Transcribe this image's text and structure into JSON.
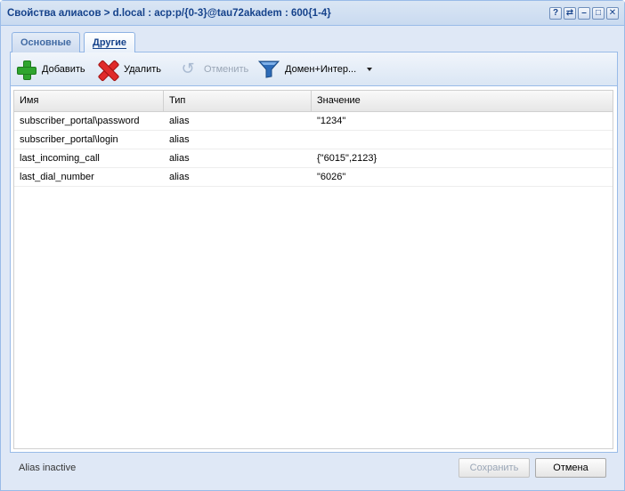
{
  "window": {
    "title": "Свойства алиасов > d.local : acp:p/{0-3}@tau72akadem : 600{1-4}",
    "tool_buttons": [
      "?",
      "⇄",
      "–",
      "□",
      "✕"
    ]
  },
  "tabs": [
    {
      "label": "Основные",
      "active": false
    },
    {
      "label": "Другие",
      "active": true
    }
  ],
  "toolbar": {
    "add_label": "Добавить",
    "delete_label": "Удалить",
    "undo_label": "Отменить",
    "filter_label": "Домен+Интер..."
  },
  "grid": {
    "columns": [
      "Имя",
      "Тип",
      "Значение"
    ],
    "rows": [
      [
        "subscriber_portal\\password",
        "alias",
        "\"1234\""
      ],
      [
        "subscriber_portal\\login",
        "alias",
        ""
      ],
      [
        "last_incoming_call",
        "alias",
        "{\"6015\",2123}"
      ],
      [
        "last_dial_number",
        "alias",
        "\"6026\""
      ]
    ]
  },
  "footer": {
    "status": "Alias inactive",
    "save_label": "Сохранить",
    "cancel_label": "Отмена"
  },
  "colors": {
    "title_text": "#15428b",
    "window_bg": "#dfe8f6",
    "border": "#99bbe8"
  }
}
